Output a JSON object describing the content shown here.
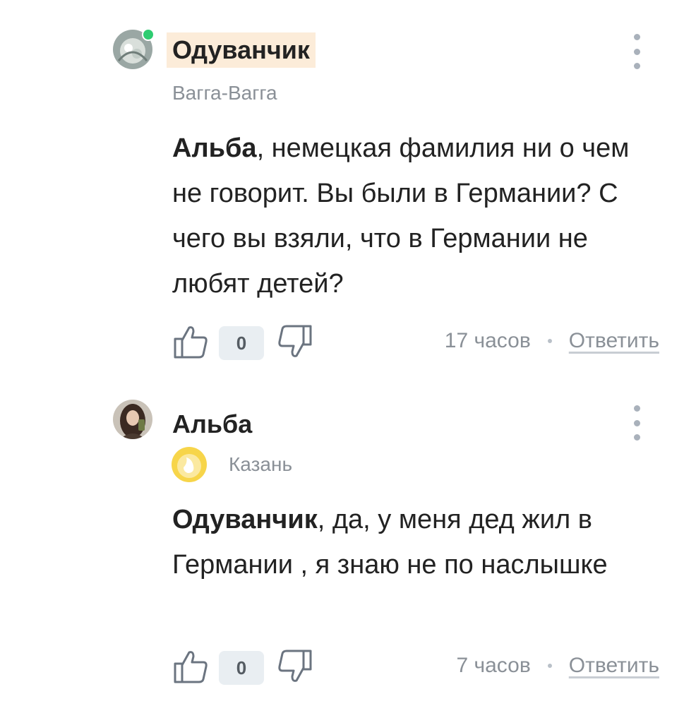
{
  "comments": [
    {
      "author": "Одуванчик",
      "online": true,
      "location": "Вагга-Вагга",
      "mention": "Альба",
      "text": ", немецкая фамилия ни о чем не говорит. Вы были в Германии? С чего вы взяли, что в Германии не любят детей?",
      "score": "0",
      "time": "17 часов",
      "reply_label": "Ответить"
    },
    {
      "author": "Альба",
      "online": false,
      "location": "Казань",
      "mention": "Одуванчик",
      "text": ", да, у меня дед жил в Германии , я знаю не по наслышке",
      "score": "0",
      "time": "7 часов",
      "reply_label": "Ответить"
    }
  ],
  "icons": {
    "like": "thumbs-up-icon",
    "dislike": "thumbs-down-icon",
    "menu": "kebab-menu-icon",
    "badge": "smiley-badge-icon"
  },
  "colors": {
    "author_highlight": "#fcecd9",
    "online": "#2ecc71",
    "muted_text": "#8a9097",
    "score_bg": "#e9eef2",
    "badge_yellow": "#f7d54a"
  }
}
